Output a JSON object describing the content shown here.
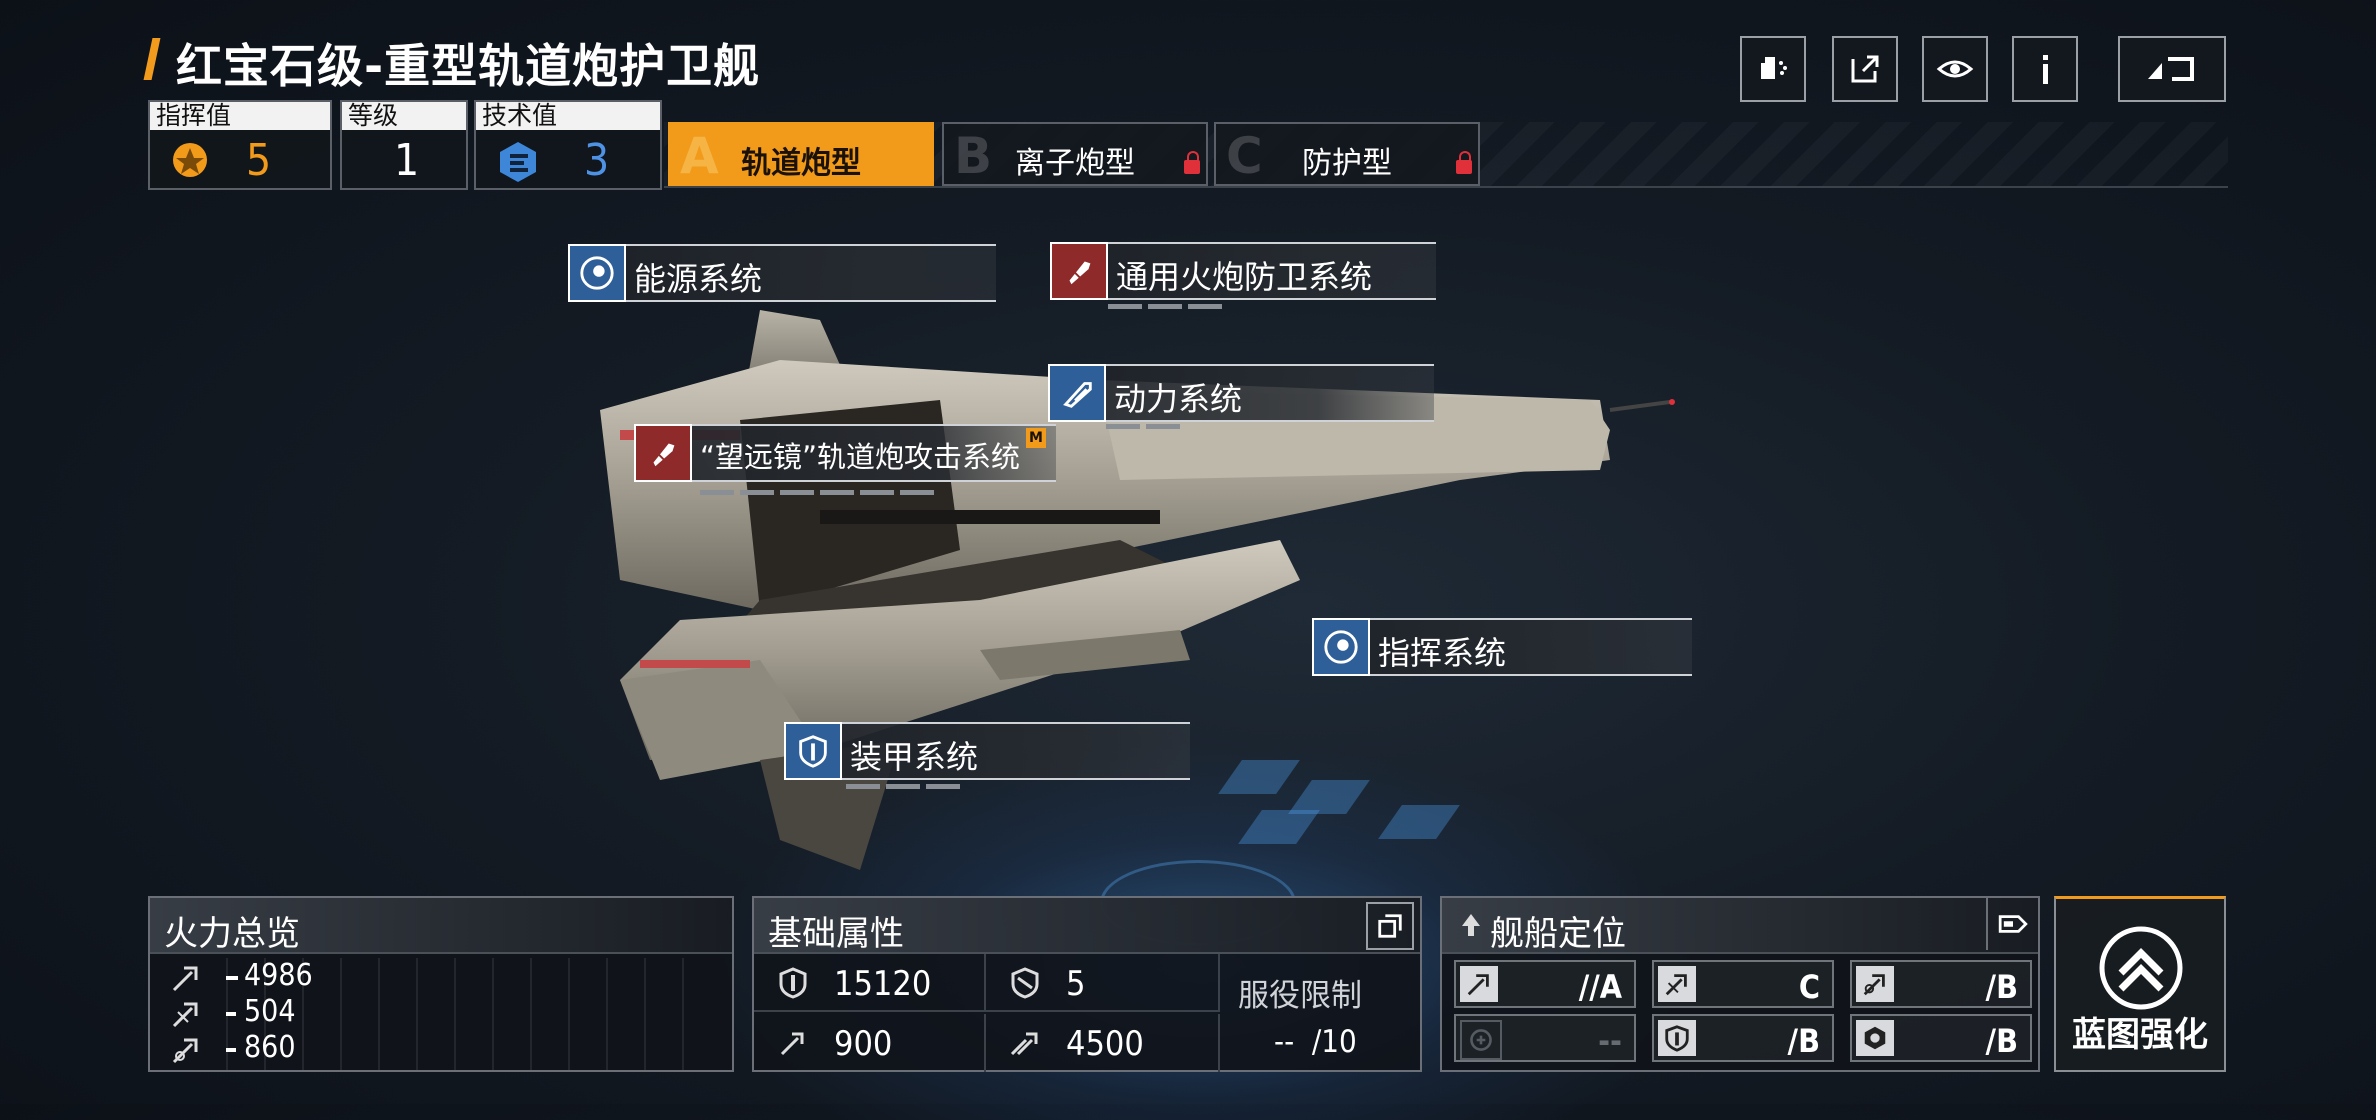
{
  "title": "红宝石级-重型轨道炮护卫舰",
  "toolbar": {
    "icons": [
      "paint-spray-icon",
      "export-icon",
      "view-eye-icon",
      "info-icon",
      "back-icon"
    ]
  },
  "stats": {
    "command": {
      "label": "指挥值",
      "value": "5"
    },
    "level": {
      "label": "等级",
      "value": "1"
    },
    "tech": {
      "label": "技术值",
      "value": "3"
    }
  },
  "tabs": [
    {
      "letter": "A",
      "label": "轨道炮型",
      "active": true,
      "locked": false
    },
    {
      "letter": "B",
      "label": "离子炮型",
      "active": false,
      "locked": true
    },
    {
      "letter": "C",
      "label": "防护型",
      "active": false,
      "locked": true
    }
  ],
  "systems": {
    "energy": "能源系统",
    "aa_gun": "通用火炮防卫系统",
    "power": "动力系统",
    "railgun": "“望远镜”轨道炮攻击系统",
    "railgun_badge": "M",
    "command": "指挥系统",
    "armor": "装甲系统"
  },
  "firepower": {
    "title": "火力总览",
    "rows": [
      "4986",
      "504",
      "860"
    ]
  },
  "base_attributes": {
    "title": "基础属性",
    "hp": "15120",
    "armor": "5",
    "speed": "900",
    "warp": "4500",
    "service_limit_label": "服役限制",
    "service_limit_value": "--  /10"
  },
  "ship_role": {
    "title": "舰船定位",
    "cells": [
      {
        "icon": "attack-icon",
        "value": "//A",
        "dim": false
      },
      {
        "icon": "anti-ship-icon",
        "value": "C",
        "dim": false
      },
      {
        "icon": "anti-air-icon",
        "value": "/B",
        "dim": false
      },
      {
        "icon": "support-icon",
        "value": "--",
        "dim": true
      },
      {
        "icon": "defense-icon",
        "value": "/B",
        "dim": false
      },
      {
        "icon": "survival-icon",
        "value": "/B",
        "dim": false
      }
    ]
  },
  "upgrade": {
    "label": "蓝图强化"
  },
  "colors": {
    "accent": "#f29a1a",
    "lock": "#e0303a",
    "blue_icon": "#2f5f98",
    "red_icon": "#8e2a2a"
  }
}
